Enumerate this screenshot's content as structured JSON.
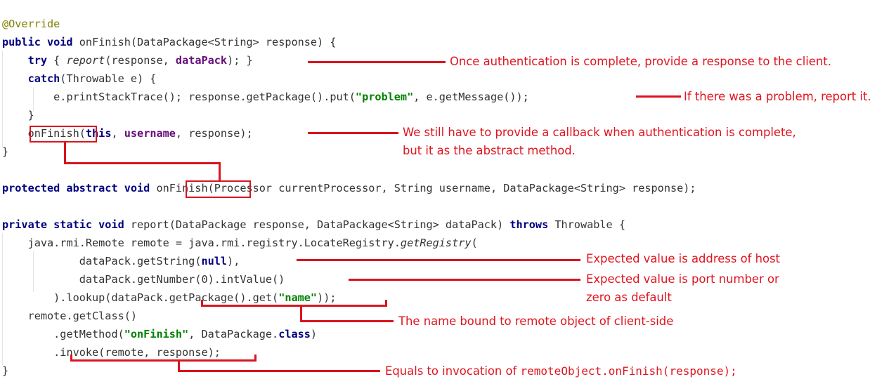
{
  "code": {
    "l1_annotation": "@Override",
    "l2": {
      "kw": "public void",
      "sig": " onFinish(DataPackage<String> response) {"
    },
    "l3": {
      "kw_try": "try",
      "open": " { ",
      "call": "report",
      "args_a": "(response, ",
      "field": "dataPack",
      "args_b": "); }"
    },
    "l4": {
      "kw_catch": "catch",
      "rest": "(Throwable e) {"
    },
    "l5": {
      "a": "e.printStackTrace(); response.getPackage().put(",
      "str": "\"problem\"",
      "b": ", e.getMessage());"
    },
    "l6": "}",
    "l7": {
      "fn": "onFinish",
      "open": "(",
      "kw_this": "this",
      "comma": ", ",
      "field": "username",
      "rest": ", response);"
    },
    "l8": "}",
    "l9": {
      "kw": "protected abstract void",
      "sp": " ",
      "fn": "onFinish",
      "rest": "(Processor currentProcessor, String username, DataPackage<String> response);"
    },
    "l10": {
      "kw": "private static void",
      "sig": " report(DataPackage response, DataPackage<String> dataPack) ",
      "kw_throws": "throws",
      "rest": " Throwable {"
    },
    "l11": {
      "a": "java.rmi.Remote remote = java.rmi.registry.LocateRegistry.",
      "it": "getRegistry",
      "b": "("
    },
    "l12": {
      "a": "dataPack.getString(",
      "kw_null": "null",
      "b": "),"
    },
    "l13": "dataPack.getNumber(0).intValue()",
    "l14": {
      "a": ").lookup(dataPack.getPackage().get(",
      "str": "\"name\"",
      "b": "));"
    },
    "l15": "remote.getClass()",
    "l16": {
      "a": ".getMethod(",
      "str": "\"onFinish\"",
      "b": ", DataPackage.",
      "kw_class": "class",
      "c": ")"
    },
    "l17": ".invoke(remote, response);",
    "l18": "}"
  },
  "notes": {
    "n1": "Once authentication is complete, provide a response to the client.",
    "n2": "If there was a problem, report it.",
    "n3_line1": "We still have to provide a callback when authentication is complete,",
    "n3_line2": "but it as the abstract method.",
    "n4": "Expected value is address of host",
    "n5_line1": "Expected value is port number or",
    "n5_line2": "zero as default",
    "n6": "The name bound to remote object of client-side",
    "n7_text": "Equals to invocation of ",
    "n7_code": "remoteObject.onFinish(response);"
  },
  "colors": {
    "keyword": "#000080",
    "annotation": "#808000",
    "string": "#008000",
    "field": "#660e7a",
    "note_red": "#e0141f"
  }
}
